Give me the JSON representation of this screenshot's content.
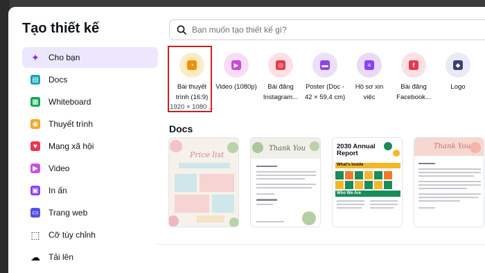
{
  "modal": {
    "title": "Tạo thiết kế"
  },
  "search": {
    "placeholder": "Bạn muốn tạo thiết kế gì?"
  },
  "sidebar": {
    "items": [
      {
        "label": "Cho bạn",
        "icon": "sparkle-icon",
        "color": "#7d2ae8",
        "active": true
      },
      {
        "label": "Docs",
        "icon": "docs-icon",
        "color": "#13a3b5"
      },
      {
        "label": "Whiteboard",
        "icon": "whiteboard-icon",
        "color": "#0ba84a"
      },
      {
        "label": "Thuyết trình",
        "icon": "presentation-icon",
        "color": "#f5a623"
      },
      {
        "label": "Mạng xã hội",
        "icon": "heart-icon",
        "color": "#e8384f"
      },
      {
        "label": "Video",
        "icon": "video-icon",
        "color": "#c750e8"
      },
      {
        "label": "In ấn",
        "icon": "print-icon",
        "color": "#8a3ffc"
      },
      {
        "label": "Trang web",
        "icon": "website-icon",
        "color": "#4f52e0"
      },
      {
        "label": "Cỡ tùy chỉnh",
        "icon": "custom-size-icon",
        "color": "#0e1318"
      },
      {
        "label": "Tải lên",
        "icon": "upload-cloud-icon",
        "color": "#0e1318"
      }
    ]
  },
  "design_types": [
    {
      "label_1": "Bài thuyết",
      "label_2": "trình (16:9)",
      "dim": "1920 × 1080 ...",
      "icon": "presentation-icon",
      "bg": "#fdebc4",
      "fg": "#f0900a"
    },
    {
      "label_1": "Video (1080p)",
      "label_2": "",
      "dim": "",
      "icon": "video-icon",
      "bg": "#f9dcf6",
      "fg": "#c74ad9"
    },
    {
      "label_1": "Bài đăng",
      "label_2": "Instagram...",
      "dim": "",
      "icon": "instagram-icon",
      "bg": "#fde0e3",
      "fg": "#e8384f"
    },
    {
      "label_1": "Poster (Dọc -",
      "label_2": "42 × 59,4 cm)",
      "dim": "",
      "icon": "poster-icon",
      "bg": "#ecdff9",
      "fg": "#8f47e0"
    },
    {
      "label_1": "Hồ sơ xin",
      "label_2": "việc",
      "dim": "",
      "icon": "resume-icon",
      "bg": "#e7dbf7",
      "fg": "#8a3ffc"
    },
    {
      "label_1": "Bài đăng",
      "label_2": "Facebook...",
      "dim": "",
      "icon": "facebook-icon",
      "bg": "#fde0e3",
      "fg": "#e8384f"
    },
    {
      "label_1": "Logo",
      "label_2": "",
      "dim": "",
      "icon": "logo-shapes-icon",
      "bg": "#e8eaf5",
      "fg": "#3b3f6e"
    }
  ],
  "docs_section": {
    "title": "Docs",
    "cards": [
      {
        "name": "Price list",
        "title_text": "Price list"
      },
      {
        "name": "Thank You doc",
        "title_text": "Thank You"
      },
      {
        "name": "Annual report",
        "title_text": "2030 Annual Report",
        "sub_1": "What's Inside",
        "sub_2": "Who We Are"
      },
      {
        "name": "Thank You letter",
        "title_text": "Thank You"
      }
    ]
  }
}
